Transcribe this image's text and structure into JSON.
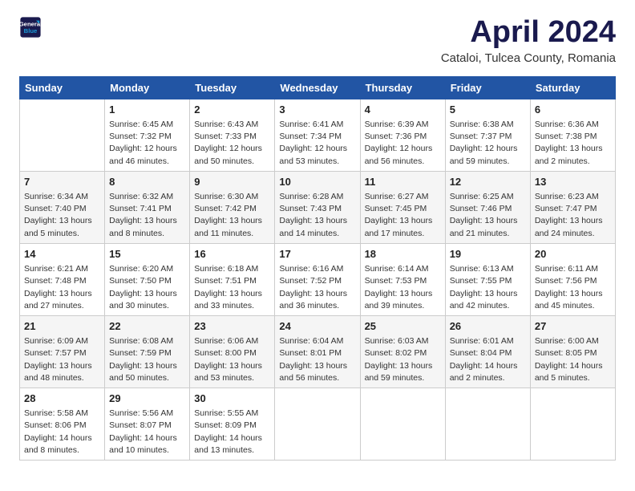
{
  "header": {
    "logo_line1": "General",
    "logo_line2": "Blue",
    "title": "April 2024",
    "subtitle": "Cataloi, Tulcea County, Romania"
  },
  "weekdays": [
    "Sunday",
    "Monday",
    "Tuesday",
    "Wednesday",
    "Thursday",
    "Friday",
    "Saturday"
  ],
  "weeks": [
    [
      {
        "day": "",
        "info": ""
      },
      {
        "day": "1",
        "info": "Sunrise: 6:45 AM\nSunset: 7:32 PM\nDaylight: 12 hours\nand 46 minutes."
      },
      {
        "day": "2",
        "info": "Sunrise: 6:43 AM\nSunset: 7:33 PM\nDaylight: 12 hours\nand 50 minutes."
      },
      {
        "day": "3",
        "info": "Sunrise: 6:41 AM\nSunset: 7:34 PM\nDaylight: 12 hours\nand 53 minutes."
      },
      {
        "day": "4",
        "info": "Sunrise: 6:39 AM\nSunset: 7:36 PM\nDaylight: 12 hours\nand 56 minutes."
      },
      {
        "day": "5",
        "info": "Sunrise: 6:38 AM\nSunset: 7:37 PM\nDaylight: 12 hours\nand 59 minutes."
      },
      {
        "day": "6",
        "info": "Sunrise: 6:36 AM\nSunset: 7:38 PM\nDaylight: 13 hours\nand 2 minutes."
      }
    ],
    [
      {
        "day": "7",
        "info": "Sunrise: 6:34 AM\nSunset: 7:40 PM\nDaylight: 13 hours\nand 5 minutes."
      },
      {
        "day": "8",
        "info": "Sunrise: 6:32 AM\nSunset: 7:41 PM\nDaylight: 13 hours\nand 8 minutes."
      },
      {
        "day": "9",
        "info": "Sunrise: 6:30 AM\nSunset: 7:42 PM\nDaylight: 13 hours\nand 11 minutes."
      },
      {
        "day": "10",
        "info": "Sunrise: 6:28 AM\nSunset: 7:43 PM\nDaylight: 13 hours\nand 14 minutes."
      },
      {
        "day": "11",
        "info": "Sunrise: 6:27 AM\nSunset: 7:45 PM\nDaylight: 13 hours\nand 17 minutes."
      },
      {
        "day": "12",
        "info": "Sunrise: 6:25 AM\nSunset: 7:46 PM\nDaylight: 13 hours\nand 21 minutes."
      },
      {
        "day": "13",
        "info": "Sunrise: 6:23 AM\nSunset: 7:47 PM\nDaylight: 13 hours\nand 24 minutes."
      }
    ],
    [
      {
        "day": "14",
        "info": "Sunrise: 6:21 AM\nSunset: 7:48 PM\nDaylight: 13 hours\nand 27 minutes."
      },
      {
        "day": "15",
        "info": "Sunrise: 6:20 AM\nSunset: 7:50 PM\nDaylight: 13 hours\nand 30 minutes."
      },
      {
        "day": "16",
        "info": "Sunrise: 6:18 AM\nSunset: 7:51 PM\nDaylight: 13 hours\nand 33 minutes."
      },
      {
        "day": "17",
        "info": "Sunrise: 6:16 AM\nSunset: 7:52 PM\nDaylight: 13 hours\nand 36 minutes."
      },
      {
        "day": "18",
        "info": "Sunrise: 6:14 AM\nSunset: 7:53 PM\nDaylight: 13 hours\nand 39 minutes."
      },
      {
        "day": "19",
        "info": "Sunrise: 6:13 AM\nSunset: 7:55 PM\nDaylight: 13 hours\nand 42 minutes."
      },
      {
        "day": "20",
        "info": "Sunrise: 6:11 AM\nSunset: 7:56 PM\nDaylight: 13 hours\nand 45 minutes."
      }
    ],
    [
      {
        "day": "21",
        "info": "Sunrise: 6:09 AM\nSunset: 7:57 PM\nDaylight: 13 hours\nand 48 minutes."
      },
      {
        "day": "22",
        "info": "Sunrise: 6:08 AM\nSunset: 7:59 PM\nDaylight: 13 hours\nand 50 minutes."
      },
      {
        "day": "23",
        "info": "Sunrise: 6:06 AM\nSunset: 8:00 PM\nDaylight: 13 hours\nand 53 minutes."
      },
      {
        "day": "24",
        "info": "Sunrise: 6:04 AM\nSunset: 8:01 PM\nDaylight: 13 hours\nand 56 minutes."
      },
      {
        "day": "25",
        "info": "Sunrise: 6:03 AM\nSunset: 8:02 PM\nDaylight: 13 hours\nand 59 minutes."
      },
      {
        "day": "26",
        "info": "Sunrise: 6:01 AM\nSunset: 8:04 PM\nDaylight: 14 hours\nand 2 minutes."
      },
      {
        "day": "27",
        "info": "Sunrise: 6:00 AM\nSunset: 8:05 PM\nDaylight: 14 hours\nand 5 minutes."
      }
    ],
    [
      {
        "day": "28",
        "info": "Sunrise: 5:58 AM\nSunset: 8:06 PM\nDaylight: 14 hours\nand 8 minutes."
      },
      {
        "day": "29",
        "info": "Sunrise: 5:56 AM\nSunset: 8:07 PM\nDaylight: 14 hours\nand 10 minutes."
      },
      {
        "day": "30",
        "info": "Sunrise: 5:55 AM\nSunset: 8:09 PM\nDaylight: 14 hours\nand 13 minutes."
      },
      {
        "day": "",
        "info": ""
      },
      {
        "day": "",
        "info": ""
      },
      {
        "day": "",
        "info": ""
      },
      {
        "day": "",
        "info": ""
      }
    ]
  ]
}
